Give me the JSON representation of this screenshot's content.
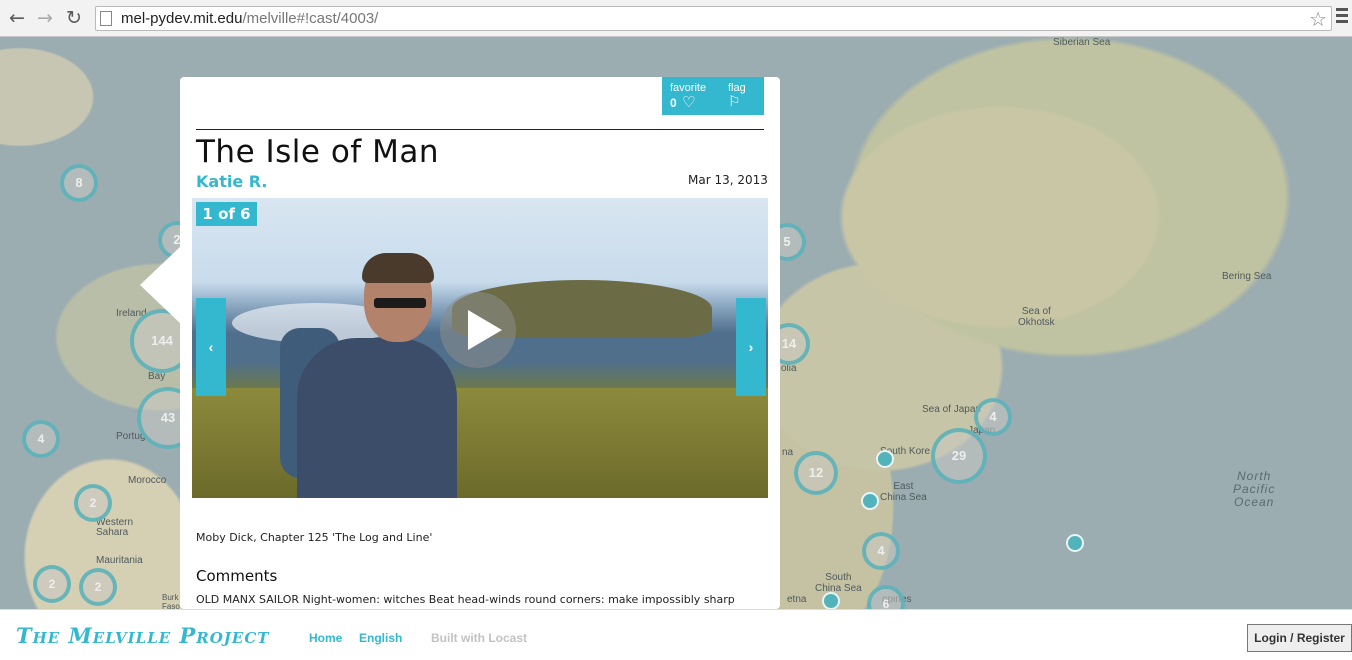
{
  "browser": {
    "back_glyph": "←",
    "forward_glyph": "→",
    "reload_glyph": "↻",
    "url_host": "mel-pydev.mit.edu",
    "url_path": "/melville#!cast/4003/",
    "star_glyph": "☆",
    "icons": [
      "back-arrow-icon",
      "forward-arrow-icon",
      "reload-icon",
      "page-icon",
      "star-icon",
      "menu-icon"
    ]
  },
  "map": {
    "labels": {
      "siberian_sea": "Siberian Sea",
      "bering_sea": "Bering Sea",
      "sea_of_okhotsk": "Sea of\nOkhotsk",
      "sea_of_japan": "Sea of Japan",
      "south_korea": "South Kore",
      "east_china_sea": "East\nChina Sea",
      "south_china_sea": "South\nChina Sea",
      "north_pacific": "North\nPacific\nOcean",
      "ireland": "Ireland",
      "bay": "Bay",
      "portugal": "Portug",
      "morocco": "Morocco",
      "western_sahara": "Western\nSahara",
      "mauritania": "Mauritania",
      "mongolia": "olia",
      "china": "na",
      "japan": "Japan",
      "burkina": "Burk\nFaso",
      "vietnam": "etna",
      "philippines": "ppines"
    },
    "clusters": [
      {
        "id": "iceland",
        "label": "8"
      },
      {
        "id": "ireland-north",
        "label": "2"
      },
      {
        "id": "ireland",
        "label": "144"
      },
      {
        "id": "spain",
        "label": "43"
      },
      {
        "id": "atlantic",
        "label": "4"
      },
      {
        "id": "canary",
        "label": "2"
      },
      {
        "id": "west-africa-1",
        "label": "2"
      },
      {
        "id": "west-africa-2",
        "label": "2"
      },
      {
        "id": "russia",
        "label": "5"
      },
      {
        "id": "mongolia",
        "label": "14"
      },
      {
        "id": "japan-north",
        "label": "4"
      },
      {
        "id": "japan",
        "label": "29"
      },
      {
        "id": "china",
        "label": "12"
      },
      {
        "id": "taiwan",
        "label": "4"
      },
      {
        "id": "philippines",
        "label": "6"
      }
    ]
  },
  "cast": {
    "favorite_label": "favorite",
    "favorite_count": "0",
    "heart_glyph": "♡",
    "flag_label": "flag",
    "flag_glyph": "⚐",
    "title": "The Isle of Man",
    "author": "Katie R.",
    "date": "Mar 13, 2013",
    "counter": "1 of 6",
    "prev_glyph": "‹",
    "next_glyph": "›",
    "caption": "Moby Dick, Chapter 125 'The Log and Line'",
    "comments_heading": "Comments",
    "comment_text": "OLD MANX SAILOR Night-women: witches Beat head-winds round corners: make impossibly sharp"
  },
  "footer": {
    "logo": "The Melville Project",
    "home": "Home",
    "language": "English",
    "built_with": "Built with Locast",
    "login": "Login / Register"
  }
}
